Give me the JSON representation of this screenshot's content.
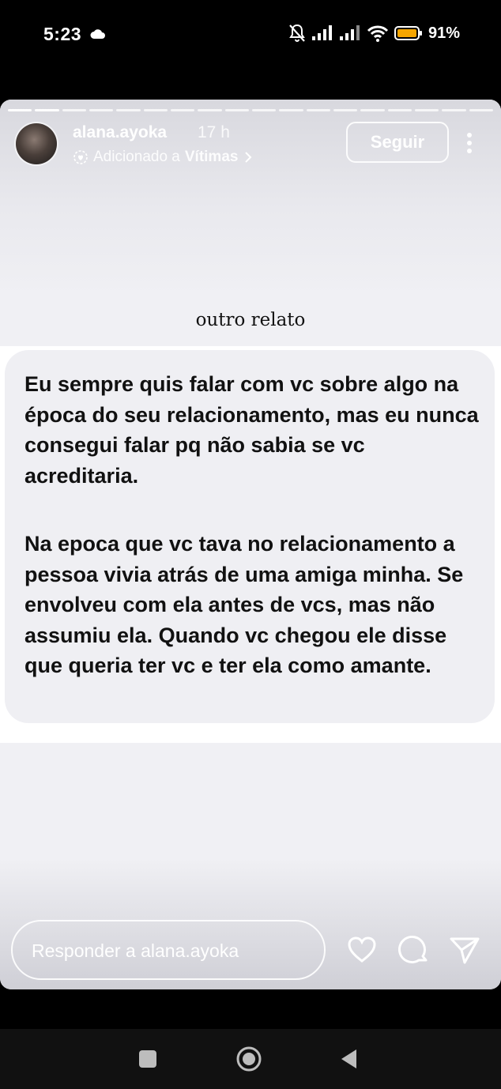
{
  "status_bar": {
    "time": "5:23",
    "battery_percent": "91%",
    "icons": [
      "cloud-icon",
      "bell-off-icon",
      "signal-icon",
      "signal-icon",
      "wifi-icon",
      "battery-icon"
    ]
  },
  "story": {
    "progress_segments_total": 18,
    "progress_segments_done": 2,
    "username": "alana.ayoka",
    "time_ago": "17 h",
    "added_prefix": "Adicionado a",
    "highlight_name": "Vítimas",
    "follow_label": "Seguir",
    "caption": "outro relato",
    "message_paragraph_1": "Eu sempre quis falar com vc sobre algo na época do seu relacionamento, mas eu nunca consegui falar pq não sabia se vc acreditaria.",
    "message_paragraph_2": "Na epoca que vc tava no relacionamento a pessoa vivia atrás de uma amiga minha. Se envolveu com ela antes de vcs, mas não assumiu ela. Quando vc chegou ele disse que queria ter vc e ter ela como amante.",
    "reply_placeholder": "Responder a alana.ayoka"
  },
  "colors": {
    "story_background": "#f0f0f4",
    "bubble_background": "#efeff3",
    "battery_fill": "#f5a500"
  }
}
